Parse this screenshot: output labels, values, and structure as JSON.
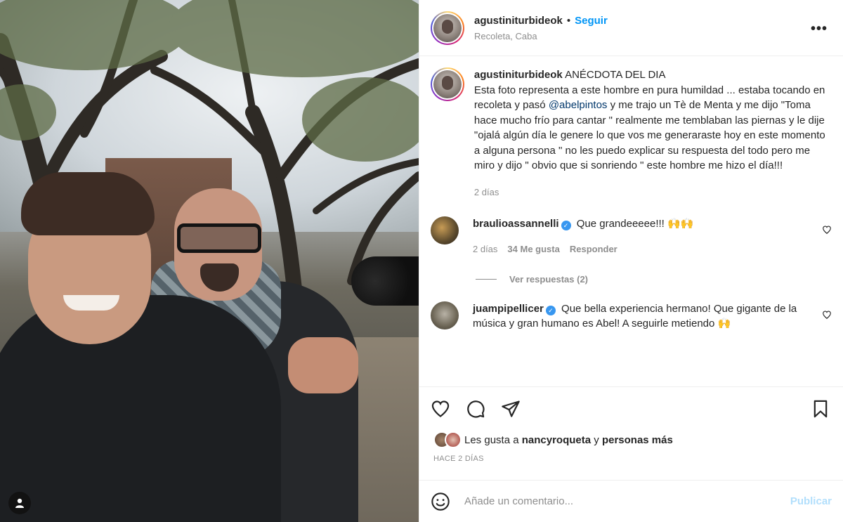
{
  "header": {
    "username": "agustiniturbideok",
    "separator": "•",
    "follow_label": "Seguir",
    "location": "Recoleta, Caba",
    "more_label": "•••"
  },
  "caption": {
    "username": "agustiniturbideok",
    "title": "ANÉCDOTA DEL DIA",
    "text_before_mention": "Esta foto representa a este hombre en pura humildad ... estaba tocando en recoleta y pasó",
    "mention": "@abelpintos",
    "text_after_mention": "y me trajo un Tè de Menta y me dijo \"Toma hace mucho frío para cantar \" realmente me temblaban las piernas y le dije \"ojalá algún día le genere lo que vos me generaraste hoy en este momento a alguna persona \" no les puedo explicar su respuesta del todo pero me miro y dijo \" obvio que si sonriendo \" este hombre me hizo el día!!!",
    "age": "2 días"
  },
  "comments": [
    {
      "username": "braulioassannelli",
      "verified_mark": "✓",
      "text": "Que grandeeeee!!! 🙌🙌",
      "age": "2 días",
      "likes": "34 Me gusta",
      "reply_label": "Responder",
      "view_replies": "Ver respuestas (2)"
    },
    {
      "username": "juampipellicer",
      "verified_mark": "✓",
      "text": "Que bella experiencia hermano! Que gigante de la música y gran humano es Abel! A seguirle metiendo 🙌"
    }
  ],
  "likes": {
    "prefix": "Les gusta a",
    "user": "nancyroqueta",
    "middle": "y",
    "others": "personas más"
  },
  "timestamp": "HACE 2 DÍAS",
  "add_comment": {
    "placeholder": "Añade un comentario...",
    "post_label": "Publicar"
  },
  "icons": {
    "like": "heart-icon",
    "comment": "comment-icon",
    "share": "share-icon",
    "save": "bookmark-icon",
    "emoji": "emoji-icon",
    "tag": "user-tag-icon"
  },
  "colors": {
    "follow": "#0095f6",
    "verified": "#3897f0",
    "muted": "#8e8e8e",
    "publish_disabled": "#b2dffc"
  }
}
